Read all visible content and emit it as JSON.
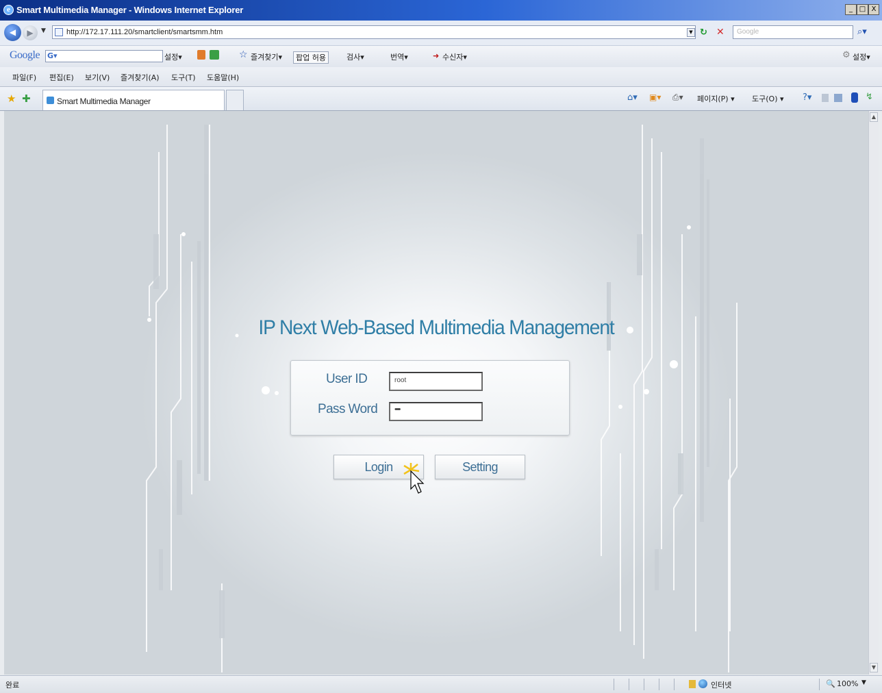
{
  "window": {
    "title": "Smart Multimedia Manager - Windows Internet Explorer",
    "controls": [
      "_",
      "□",
      "X"
    ]
  },
  "address_bar": {
    "url": "http://172.17.111.20/smartclient/smartsmm.htm",
    "search_placeholder": "Google"
  },
  "google_toolbar": {
    "logo": "Google",
    "g_label": "G▾",
    "items": [
      "설정▾",
      "즐겨찾기▾",
      "팝업 허용",
      "검사▾",
      "번역▾",
      "수신자▾"
    ],
    "settings": "설정▾"
  },
  "menu": {
    "items": [
      "파일(F)",
      "편집(E)",
      "보기(V)",
      "즐겨찾기(A)",
      "도구(T)",
      "도움말(H)"
    ]
  },
  "tabs": {
    "active": "Smart Multimedia Manager",
    "command_bar": [
      "페이지(P) ▾",
      "도구(O) ▾"
    ]
  },
  "page": {
    "heading": "IP Next Web-Based Multimedia Management",
    "user_id_label": "User ID",
    "user_id_value": "root",
    "password_label": "Pass Word",
    "password_value": "••••",
    "login_button": "Login",
    "setting_button": "Setting"
  },
  "status": {
    "left": "완료",
    "zone": "인터넷",
    "zoom": "100%"
  }
}
